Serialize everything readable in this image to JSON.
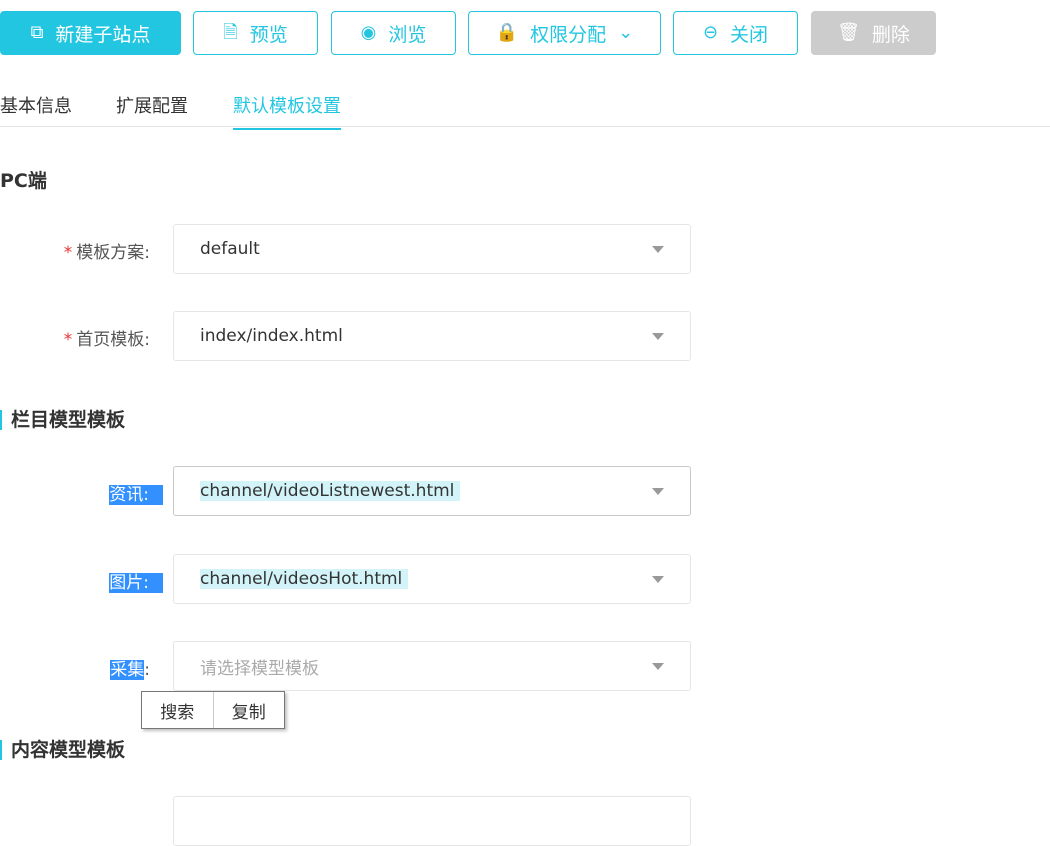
{
  "toolbar": {
    "new_site": "新建子站点",
    "preview": "预览",
    "browse": "浏览",
    "permissions": "权限分配",
    "close": "关闭",
    "delete": "删除"
  },
  "tabs": [
    "基本信息",
    "扩展配置",
    "默认模板设置"
  ],
  "pc": {
    "title": "PC端",
    "scheme_label": "模板方案:",
    "scheme_value": "default",
    "home_label": "首页模板:",
    "home_value": "index/index.html"
  },
  "channel": {
    "title": "栏目模型模板",
    "rows": [
      {
        "label": "资讯:",
        "value": "channel/videoListnewest.html"
      },
      {
        "label": "图片:",
        "value": "channel/videosHot.html"
      },
      {
        "label_sel": "采集",
        "label_rest": ":",
        "placeholder": "请选择模型模板"
      }
    ]
  },
  "context_menu": {
    "search": "搜索",
    "copy": "复制"
  },
  "content": {
    "title": "内容模型模板"
  },
  "colors": {
    "accent": "#23c6e0",
    "disabled": "#cccccc",
    "selection": "#3390ff"
  }
}
